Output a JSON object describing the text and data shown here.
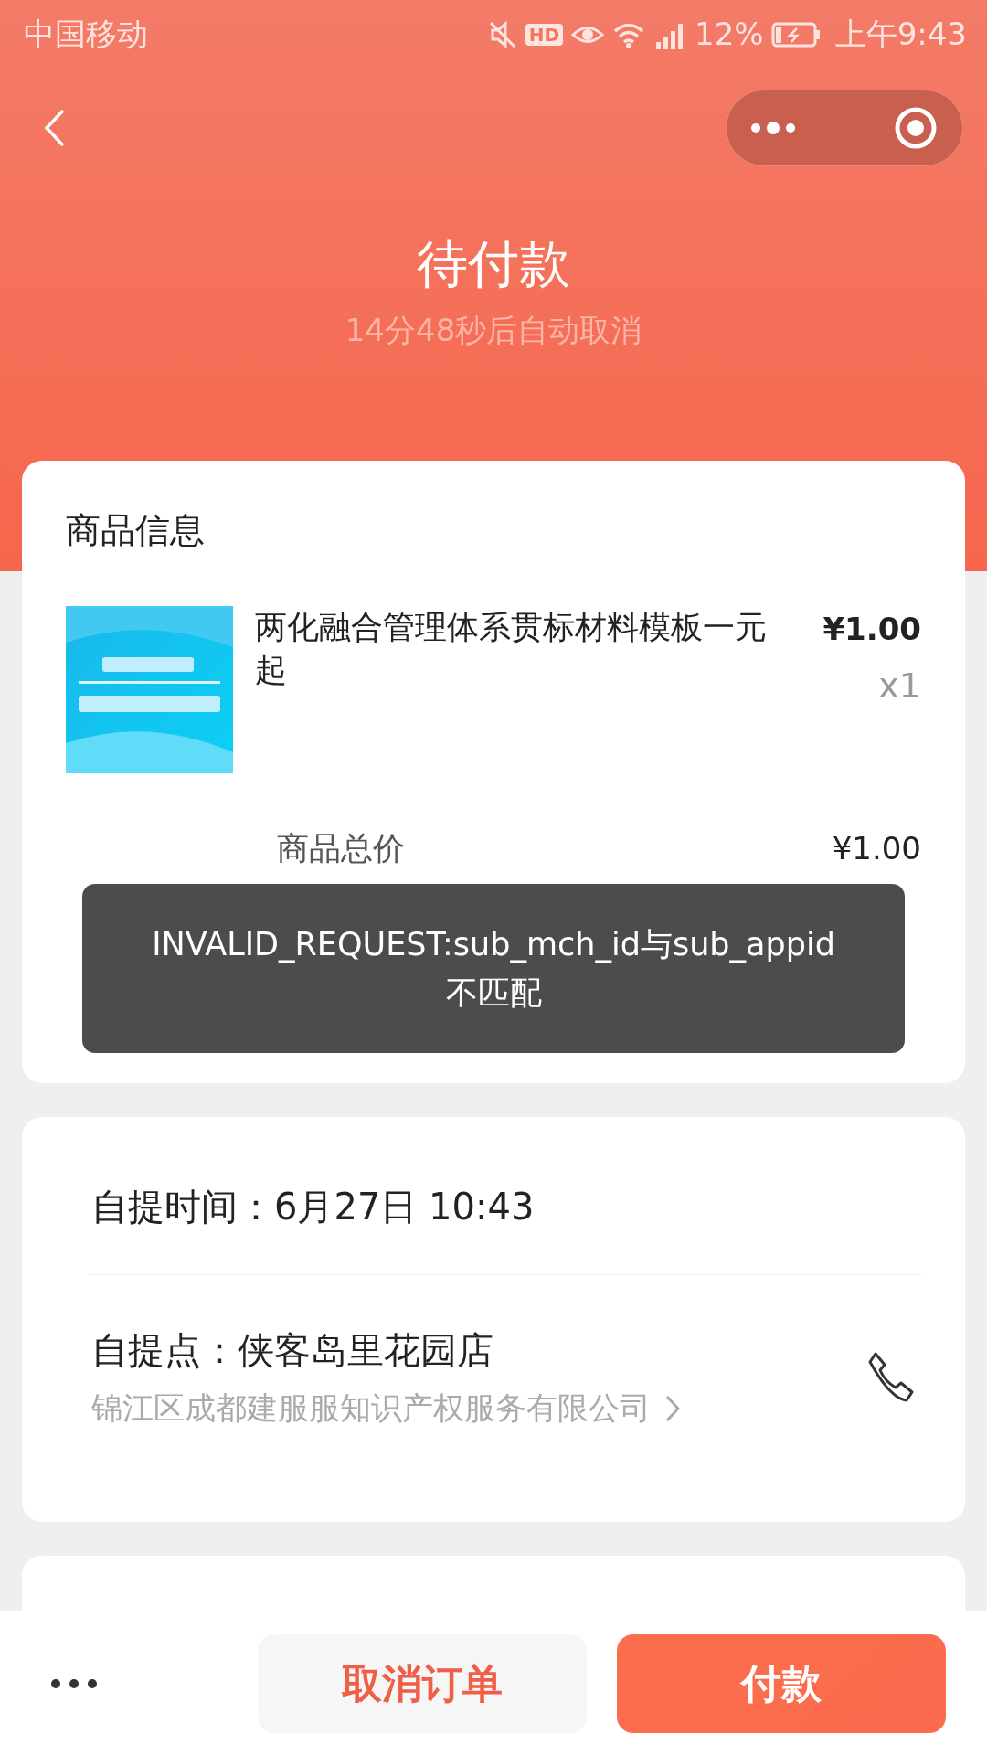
{
  "status_bar": {
    "carrier": "中国移动",
    "hd_badge": "HD",
    "battery": "12%",
    "time": "上午9:43"
  },
  "header": {
    "title": "待付款",
    "subtitle": "14分48秒后自动取消"
  },
  "goods_card": {
    "title": "商品信息",
    "items": [
      {
        "kind": "picture",
        "name": "两化融合管理体系贯标材料模板一元起",
        "price": "¥1.00",
        "quantity": "x1"
      }
    ],
    "total_label": "商品总价",
    "total_value": "¥1.00"
  },
  "toast": {
    "lines": [
      "INVALID_REQUEST:sub_mch_id与sub_appid",
      "不匹配"
    ]
  },
  "pickup_card": {
    "time_text": "自提时间：6月27日 10:43",
    "point_text": "自提点：侠客岛里花园店",
    "address": "锦江区成都建服服知识产权服务有限公司"
  },
  "bottom_bar": {
    "buttons": [
      {
        "kind": "secondary",
        "label": "取消订单"
      },
      {
        "kind": "primary",
        "label": "付款"
      }
    ]
  }
}
